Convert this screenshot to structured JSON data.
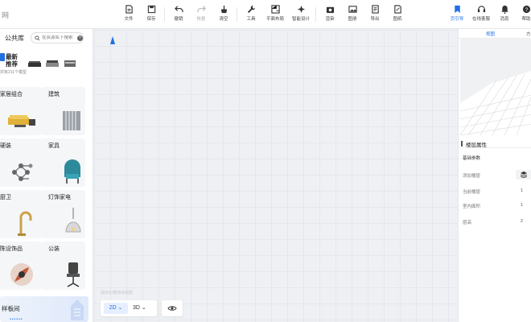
{
  "toolbar": {
    "logo_fragment": "网",
    "buttons": [
      {
        "label": "文件",
        "icon": "file-icon"
      },
      {
        "label": "保存",
        "icon": "save-icon"
      },
      {
        "label": "撤销",
        "icon": "undo-icon"
      },
      {
        "label": "恢复",
        "icon": "redo-icon"
      },
      {
        "label": "清空",
        "icon": "clear-icon"
      },
      {
        "label": "工具",
        "icon": "wrench-icon"
      },
      {
        "label": "平面布局",
        "icon": "layout-icon"
      },
      {
        "label": "智能设计",
        "icon": "smart-design-icon"
      },
      {
        "label": "渲染",
        "icon": "camera-icon"
      },
      {
        "label": "图册",
        "icon": "album-icon"
      },
      {
        "label": "导出",
        "icon": "export-icon"
      },
      {
        "label": "图纸",
        "icon": "drawing-icon"
      },
      {
        "label": "页引导",
        "icon": "bookmark-icon"
      },
      {
        "label": "在线客服",
        "icon": "headset-icon"
      },
      {
        "label": "消息",
        "icon": "bell-icon"
      },
      {
        "label": "帮助",
        "icon": "help-icon"
      }
    ]
  },
  "left_panel": {
    "title": "公共库",
    "search_placeholder": "在资源库下搜索",
    "recommend": {
      "title_line1": "最新",
      "title_line2": "推荐",
      "count": "共有211个模型"
    },
    "categories": [
      {
        "name": "家居组合",
        "icon": "sofa-set-icon"
      },
      {
        "name": "建筑",
        "icon": "fence-icon"
      },
      {
        "name": "硬装",
        "icon": "molecule-icon"
      },
      {
        "name": "家具",
        "icon": "armchair-icon"
      },
      {
        "name": "厨卫",
        "icon": "faucet-icon"
      },
      {
        "name": "灯饰家电",
        "icon": "pendant-lamp-icon"
      },
      {
        "name": "陈设饰品",
        "icon": "decor-icon"
      },
      {
        "name": "公装",
        "icon": "office-chair-icon"
      }
    ],
    "banner": "样板间"
  },
  "canvas": {
    "hint": "鼠标右键拖动视图",
    "view_2d": "2D",
    "view_3d": "3D"
  },
  "right_panel": {
    "tabs": [
      "视图",
      "方"
    ],
    "properties_title": "楼层属性",
    "section_title": "基础参数",
    "rows": [
      {
        "key": "添加楼层",
        "value": ""
      },
      {
        "key": "当前楼层",
        "value": "1"
      },
      {
        "key": "室内面积",
        "value": "1"
      },
      {
        "key": "层高",
        "value": "2"
      }
    ]
  },
  "colors": {
    "accent": "#1f6fe5",
    "panel": "#ffffff",
    "canvas": "#eef0f4"
  }
}
